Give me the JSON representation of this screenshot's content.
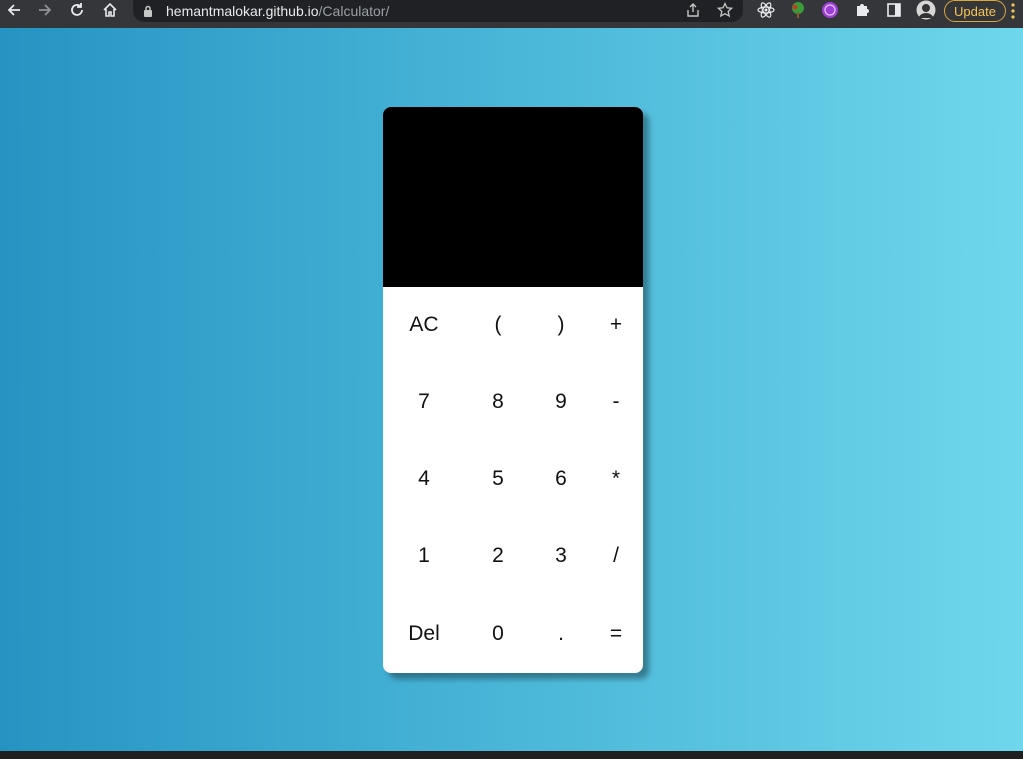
{
  "browser": {
    "url_host": "hemantmalokar.github.io",
    "url_path": "/Calculator/",
    "update_label": "Update",
    "icons": [
      "back-icon",
      "forward-icon",
      "reload-icon",
      "home-icon",
      "lock-icon",
      "share-icon",
      "bookmark-star-icon",
      "react-devtools-icon",
      "tree-extension-icon",
      "purple-extension-icon",
      "extensions-puzzle-icon",
      "side-panel-icon",
      "profile-avatar-icon",
      "kebab-menu-icon"
    ]
  },
  "calculator": {
    "display_value": "",
    "keys": [
      [
        "AC",
        "(",
        ")",
        "+"
      ],
      [
        "7",
        "8",
        "9",
        "-"
      ],
      [
        "4",
        "5",
        "6",
        "*"
      ],
      [
        "1",
        "2",
        "3",
        "/"
      ],
      [
        "Del",
        "0",
        ".",
        "="
      ]
    ]
  },
  "colors": {
    "gradient_start": "#2594c2",
    "gradient_end": "#6fd7ec",
    "display_bg": "#000000",
    "keypad_bg": "#ffffff",
    "update_accent": "#f6c453"
  }
}
